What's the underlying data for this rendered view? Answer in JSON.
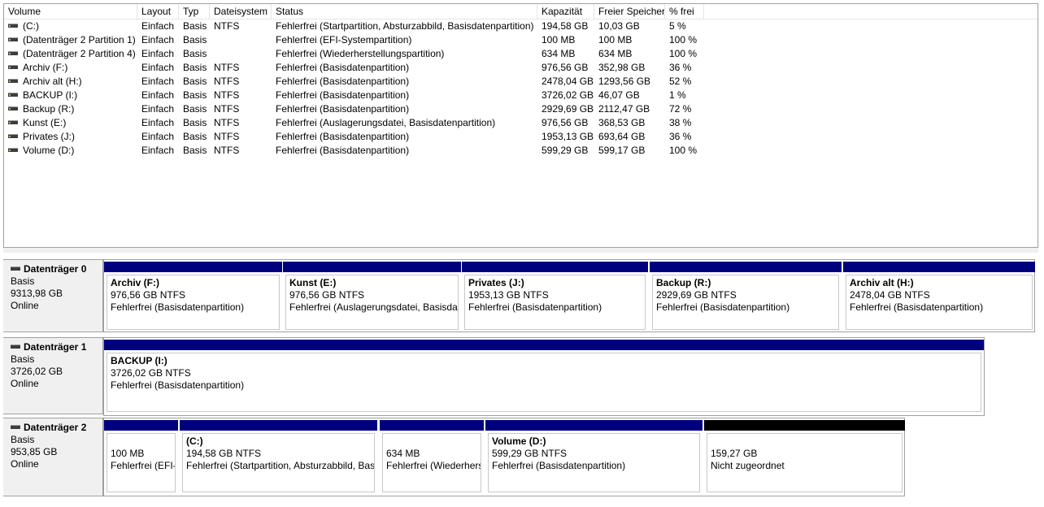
{
  "list": {
    "columns": [
      "Volume",
      "Layout",
      "Typ",
      "Dateisystem",
      "Status",
      "Kapazität",
      "Freier Speicher",
      "% frei"
    ],
    "rows": [
      {
        "volume": "(C:)",
        "layout": "Einfach",
        "typ": "Basis",
        "fs": "NTFS",
        "status": "Fehlerfrei (Startpartition, Absturzabbild, Basisdatenpartition)",
        "cap": "194,58 GB",
        "free": "10,03 GB",
        "pct": "5 %"
      },
      {
        "volume": "(Datenträger 2 Partition 1)",
        "layout": "Einfach",
        "typ": "Basis",
        "fs": "",
        "status": "Fehlerfrei (EFI-Systempartition)",
        "cap": "100 MB",
        "free": "100 MB",
        "pct": "100 %"
      },
      {
        "volume": "(Datenträger 2 Partition 4)",
        "layout": "Einfach",
        "typ": "Basis",
        "fs": "",
        "status": "Fehlerfrei (Wiederherstellungspartition)",
        "cap": "634 MB",
        "free": "634 MB",
        "pct": "100 %"
      },
      {
        "volume": "Archiv (F:)",
        "layout": "Einfach",
        "typ": "Basis",
        "fs": "NTFS",
        "status": "Fehlerfrei (Basisdatenpartition)",
        "cap": "976,56 GB",
        "free": "352,98 GB",
        "pct": "36 %"
      },
      {
        "volume": "Archiv alt (H:)",
        "layout": "Einfach",
        "typ": "Basis",
        "fs": "NTFS",
        "status": "Fehlerfrei (Basisdatenpartition)",
        "cap": "2478,04 GB",
        "free": "1293,56 GB",
        "pct": "52 %"
      },
      {
        "volume": "BACKUP (I:)",
        "layout": "Einfach",
        "typ": "Basis",
        "fs": "NTFS",
        "status": "Fehlerfrei (Basisdatenpartition)",
        "cap": "3726,02 GB",
        "free": "46,07 GB",
        "pct": "1 %"
      },
      {
        "volume": "Backup (R:)",
        "layout": "Einfach",
        "typ": "Basis",
        "fs": "NTFS",
        "status": "Fehlerfrei (Basisdatenpartition)",
        "cap": "2929,69 GB",
        "free": "2112,47 GB",
        "pct": "72 %"
      },
      {
        "volume": "Kunst (E:)",
        "layout": "Einfach",
        "typ": "Basis",
        "fs": "NTFS",
        "status": "Fehlerfrei (Auslagerungsdatei, Basisdatenpartition)",
        "cap": "976,56 GB",
        "free": "368,53 GB",
        "pct": "38 %"
      },
      {
        "volume": "Privates (J:)",
        "layout": "Einfach",
        "typ": "Basis",
        "fs": "NTFS",
        "status": "Fehlerfrei (Basisdatenpartition)",
        "cap": "1953,13 GB",
        "free": "693,64 GB",
        "pct": "36 %"
      },
      {
        "volume": "Volume (D:)",
        "layout": "Einfach",
        "typ": "Basis",
        "fs": "NTFS",
        "status": "Fehlerfrei (Basisdatenpartition)",
        "cap": "599,29 GB",
        "free": "599,17 GB",
        "pct": "100 %"
      }
    ]
  },
  "disks": [
    {
      "name": "Datenträger 0",
      "type": "Basis",
      "size": "9313,98 GB",
      "state": "Online",
      "partitions": [
        {
          "name": "Archiv  (F:)",
          "line1": "976,56 GB NTFS",
          "line2": "Fehlerfrei (Basisdatenpartition)",
          "unallocated": false
        },
        {
          "name": "Kunst  (E:)",
          "line1": "976,56 GB NTFS",
          "line2": "Fehlerfrei (Auslagerungsdatei, Basisdat",
          "unallocated": false
        },
        {
          "name": "Privates  (J:)",
          "line1": "1953,13 GB NTFS",
          "line2": "Fehlerfrei (Basisdatenpartition)",
          "unallocated": false
        },
        {
          "name": "Backup  (R:)",
          "line1": "2929,69 GB NTFS",
          "line2": "Fehlerfrei (Basisdatenpartition)",
          "unallocated": false
        },
        {
          "name": "Archiv alt  (H:)",
          "line1": "2478,04 GB NTFS",
          "line2": "Fehlerfrei (Basisdatenpartition)",
          "unallocated": false
        }
      ]
    },
    {
      "name": "Datenträger 1",
      "type": "Basis",
      "size": "3726,02 GB",
      "state": "Online",
      "partitions": [
        {
          "name": "BACKUP  (I:)",
          "line1": "3726,02 GB NTFS",
          "line2": "Fehlerfrei (Basisdatenpartition)",
          "unallocated": false
        }
      ]
    },
    {
      "name": "Datenträger 2",
      "type": "Basis",
      "size": "953,85 GB",
      "state": "Online",
      "partitions": [
        {
          "name": "",
          "line1": "100 MB",
          "line2": "Fehlerfrei (EFI-",
          "unallocated": false
        },
        {
          "name": "(C:)",
          "line1": "194,58 GB NTFS",
          "line2": "Fehlerfrei (Startpartition, Absturzabbild, Basi",
          "unallocated": false
        },
        {
          "name": "",
          "line1": "634 MB",
          "line2": "Fehlerfrei (Wiederhers",
          "unallocated": false
        },
        {
          "name": "Volume  (D:)",
          "line1": "599,29 GB NTFS",
          "line2": "Fehlerfrei (Basisdatenpartition)",
          "unallocated": false
        },
        {
          "name": "",
          "line1": "159,27 GB",
          "line2": "Nicht zugeordnet",
          "unallocated": true
        }
      ]
    }
  ]
}
